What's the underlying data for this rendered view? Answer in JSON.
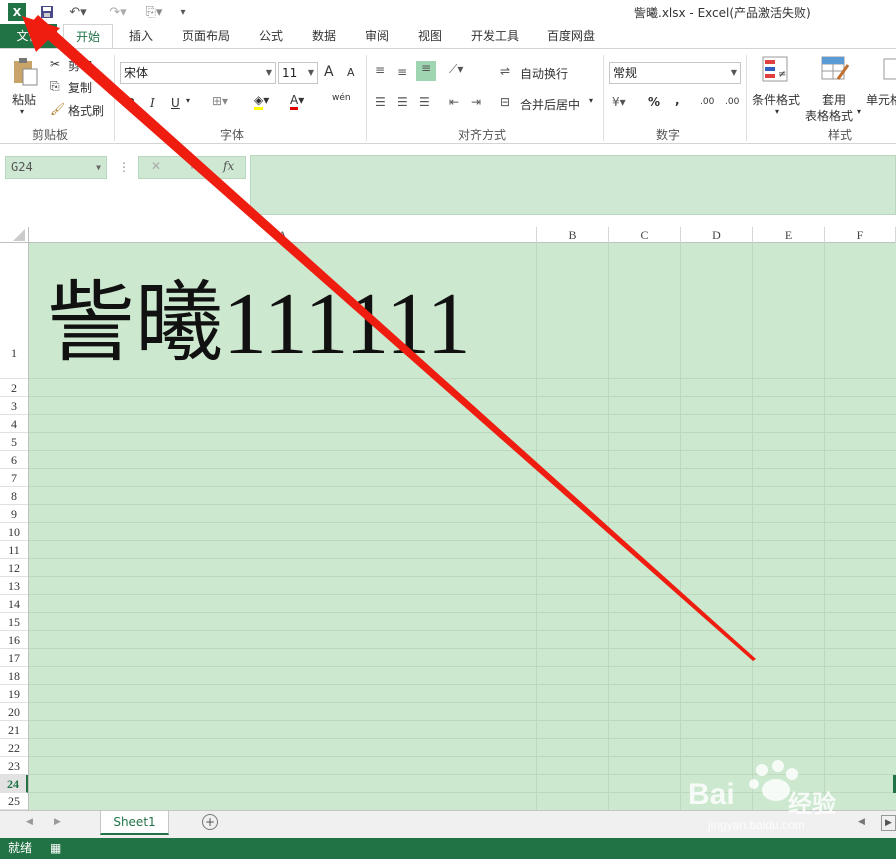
{
  "window": {
    "title": "訾曦.xlsx - Excel(产品激活失败)",
    "app_icon": "excel-icon",
    "quick_access": [
      "save-icon",
      "undo-icon",
      "redo-icon",
      "format-icon",
      "customize-icon"
    ]
  },
  "tabs": [
    "文件",
    "开始",
    "插入",
    "页面布局",
    "公式",
    "数据",
    "审阅",
    "视图",
    "开发工具",
    "百度网盘"
  ],
  "clipboard": {
    "paste": "粘贴",
    "cut": "剪切",
    "copy": "复制",
    "format_painter": "格式刷",
    "label": "剪贴板"
  },
  "font": {
    "name": "宋体",
    "size": "11",
    "label": "字体",
    "bold": "B",
    "italic": "I",
    "underline": "U",
    "grow": "A",
    "shrink": "A",
    "phonetic": "wén",
    "font_color": "A"
  },
  "alignment": {
    "wrap": "自动换行",
    "merge": "合并后居中",
    "label": "对齐方式"
  },
  "number": {
    "format": "常规",
    "percent": "%",
    "comma": ",",
    "inc_dec": ".00",
    "label": "数字"
  },
  "styles": {
    "conditional": "条件格式",
    "table_format_1": "套用",
    "table_format_2": "表格格式",
    "cell_styles": "单元格",
    "label": "样式"
  },
  "formula_bar": {
    "name_box": "G24",
    "fx": "fx",
    "cancel": "✕",
    "enter": "✓",
    "value": ""
  },
  "columns": [
    "A",
    "B",
    "C",
    "D",
    "E",
    "F"
  ],
  "rows": [
    "1",
    "2",
    "3",
    "4",
    "5",
    "6",
    "7",
    "8",
    "9",
    "10",
    "11",
    "12",
    "13",
    "14",
    "15",
    "16",
    "17",
    "18",
    "19",
    "20",
    "21",
    "22",
    "23",
    "24",
    "25"
  ],
  "cells": {
    "A1": "訾曦111111"
  },
  "sheets": [
    "Sheet1"
  ],
  "status": {
    "text": "就绪"
  },
  "colors": {
    "accent": "#217346",
    "grid_bg": "#cce8cf",
    "arrow": "#ee1d10"
  },
  "watermark": {
    "brand": "Bai",
    "brand2": "经验",
    "url": "jingyan.baidu.com"
  }
}
